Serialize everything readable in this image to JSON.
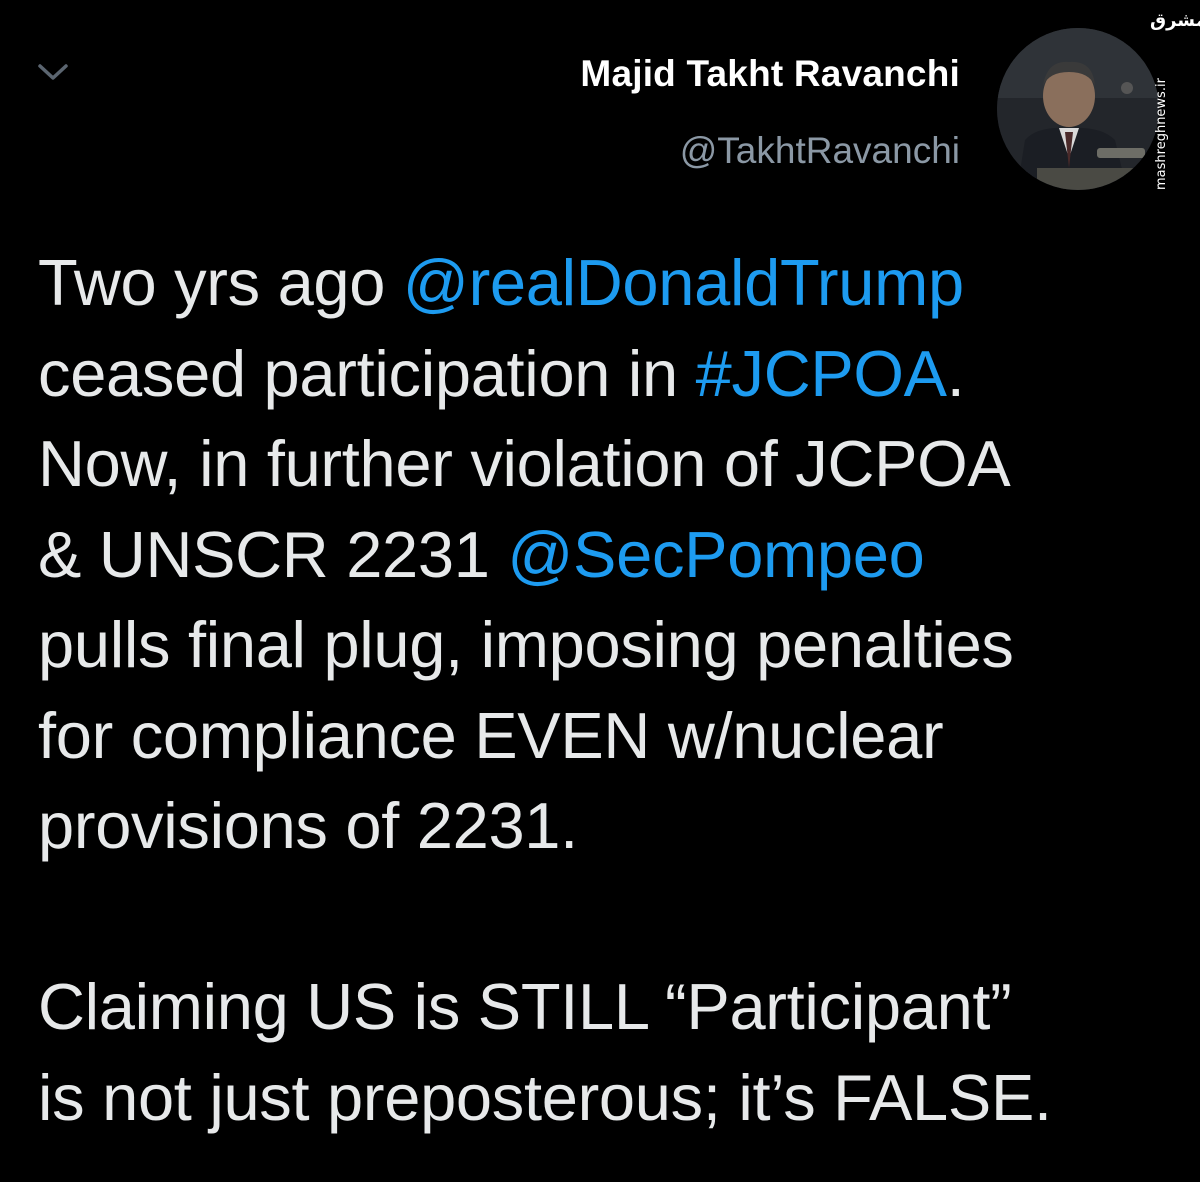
{
  "header": {
    "collapse_icon": "chevron-down-icon"
  },
  "author": {
    "name": "Majid Takht Ravanchi",
    "handle": "@TakhtRavanchi",
    "avatar_icon": "user-avatar"
  },
  "watermark": {
    "logo_text": "مشرق",
    "site": "mashreghnews.ir"
  },
  "tweet": {
    "line1_text": "Two yrs ago ",
    "mention_trump": "@realDonaldTrump",
    "line2_text": "ceased participation in ",
    "hashtag_jcpoa": "#JCPOA",
    "line2_end": ".",
    "line3_text": "Now, in further violation of JCPOA",
    "line4_text": "& UNSCR 2231 ",
    "mention_pompeo": "@SecPompeo",
    "line5_text": "pulls final plug, imposing penalties",
    "line6_text": "for compliance EVEN w/nuclear",
    "line7_text": "provisions of 2231.",
    "line8_text": "Claiming US is STILL “Participant”",
    "line9_text": "is not just preposterous; it’s FALSE."
  },
  "colors": {
    "background": "#000000",
    "text": "#e7e9ea",
    "handle": "#8b98a5",
    "link": "#1d9bf0"
  }
}
